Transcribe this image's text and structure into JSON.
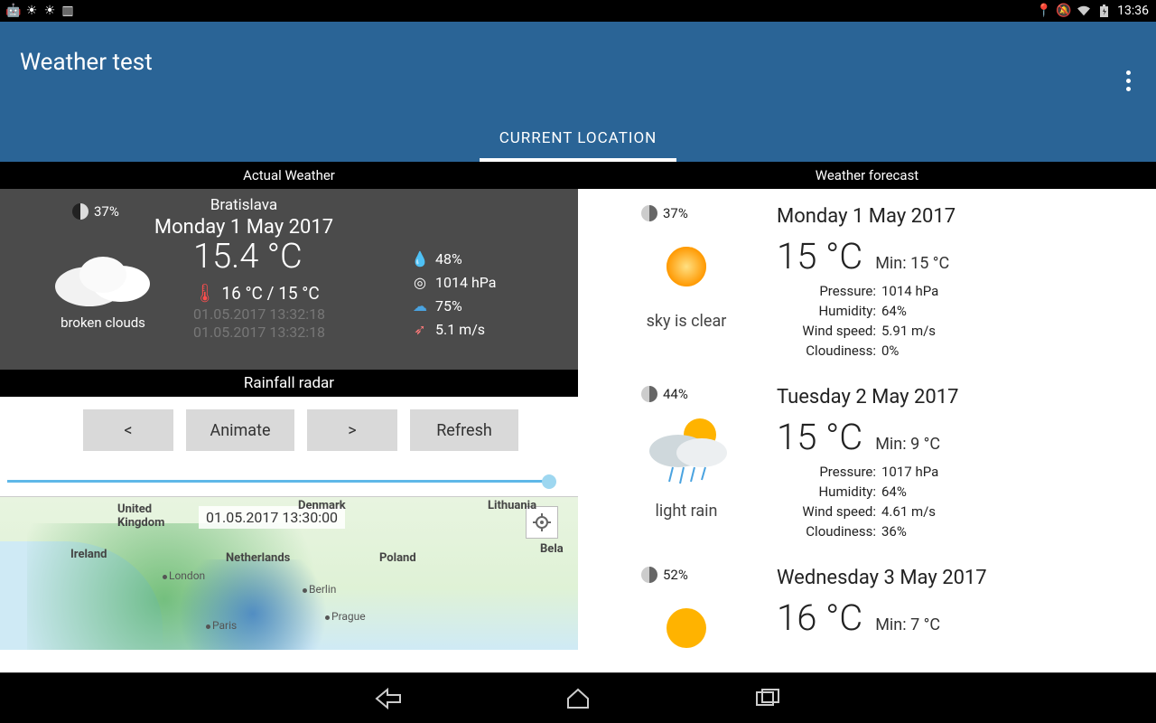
{
  "status": {
    "time": "13:36"
  },
  "header": {
    "title": "Weather test",
    "tab": "CURRENT LOCATION"
  },
  "sections": {
    "left": "Actual Weather",
    "right": "Weather forecast"
  },
  "actual": {
    "moon_pct": "37%",
    "city": "Bratislava",
    "date": "Monday 1 May 2017",
    "temp": "15.4 °C",
    "range": "16 °C / 15 °C",
    "condition": "broken clouds",
    "stamp1": "01.05.2017 13:32:18",
    "stamp2": "01.05.2017 13:32:18",
    "humidity": "48%",
    "pressure": "1014 hPa",
    "cloud": "75%",
    "wind": "5.1 m/s"
  },
  "radar": {
    "header": "Rainfall radar",
    "prev": "<",
    "animate": "Animate",
    "next": ">",
    "refresh": "Refresh",
    "stamp": "01.05.2017 13:30:00",
    "places": {
      "uk": "United\nKingdom",
      "ireland": "Ireland",
      "netherlands": "Netherlands",
      "london": "London",
      "berlin": "Berlin",
      "paris": "Paris",
      "prague": "Prague",
      "poland": "Poland",
      "denmark": "Denmark",
      "lithuania": "Lithuania",
      "bela": "Bela"
    }
  },
  "forecast": [
    {
      "moon_pct": "37%",
      "date": "Monday 1 May 2017",
      "temp": "15 °C",
      "min": "Min: 15 °C",
      "condition": "sky is clear",
      "stats": {
        "Pressure:": "1014 hPa",
        "Humidity:": "64%",
        "Wind speed:": "5.91 m/s",
        "Cloudiness:": "0%"
      },
      "icon": "sun"
    },
    {
      "moon_pct": "44%",
      "date": "Tuesday 2 May 2017",
      "temp": "15 °C",
      "min": "Min: 9 °C",
      "condition": "light rain",
      "stats": {
        "Pressure:": "1017 hPa",
        "Humidity:": "64%",
        "Wind speed:": "4.61 m/s",
        "Cloudiness:": "36%"
      },
      "icon": "raincloud"
    },
    {
      "moon_pct": "52%",
      "date": "Wednesday 3 May 2017",
      "temp": "16 °C",
      "min": "Min: 7 °C",
      "condition": "",
      "stats": {},
      "icon": "sun"
    }
  ]
}
